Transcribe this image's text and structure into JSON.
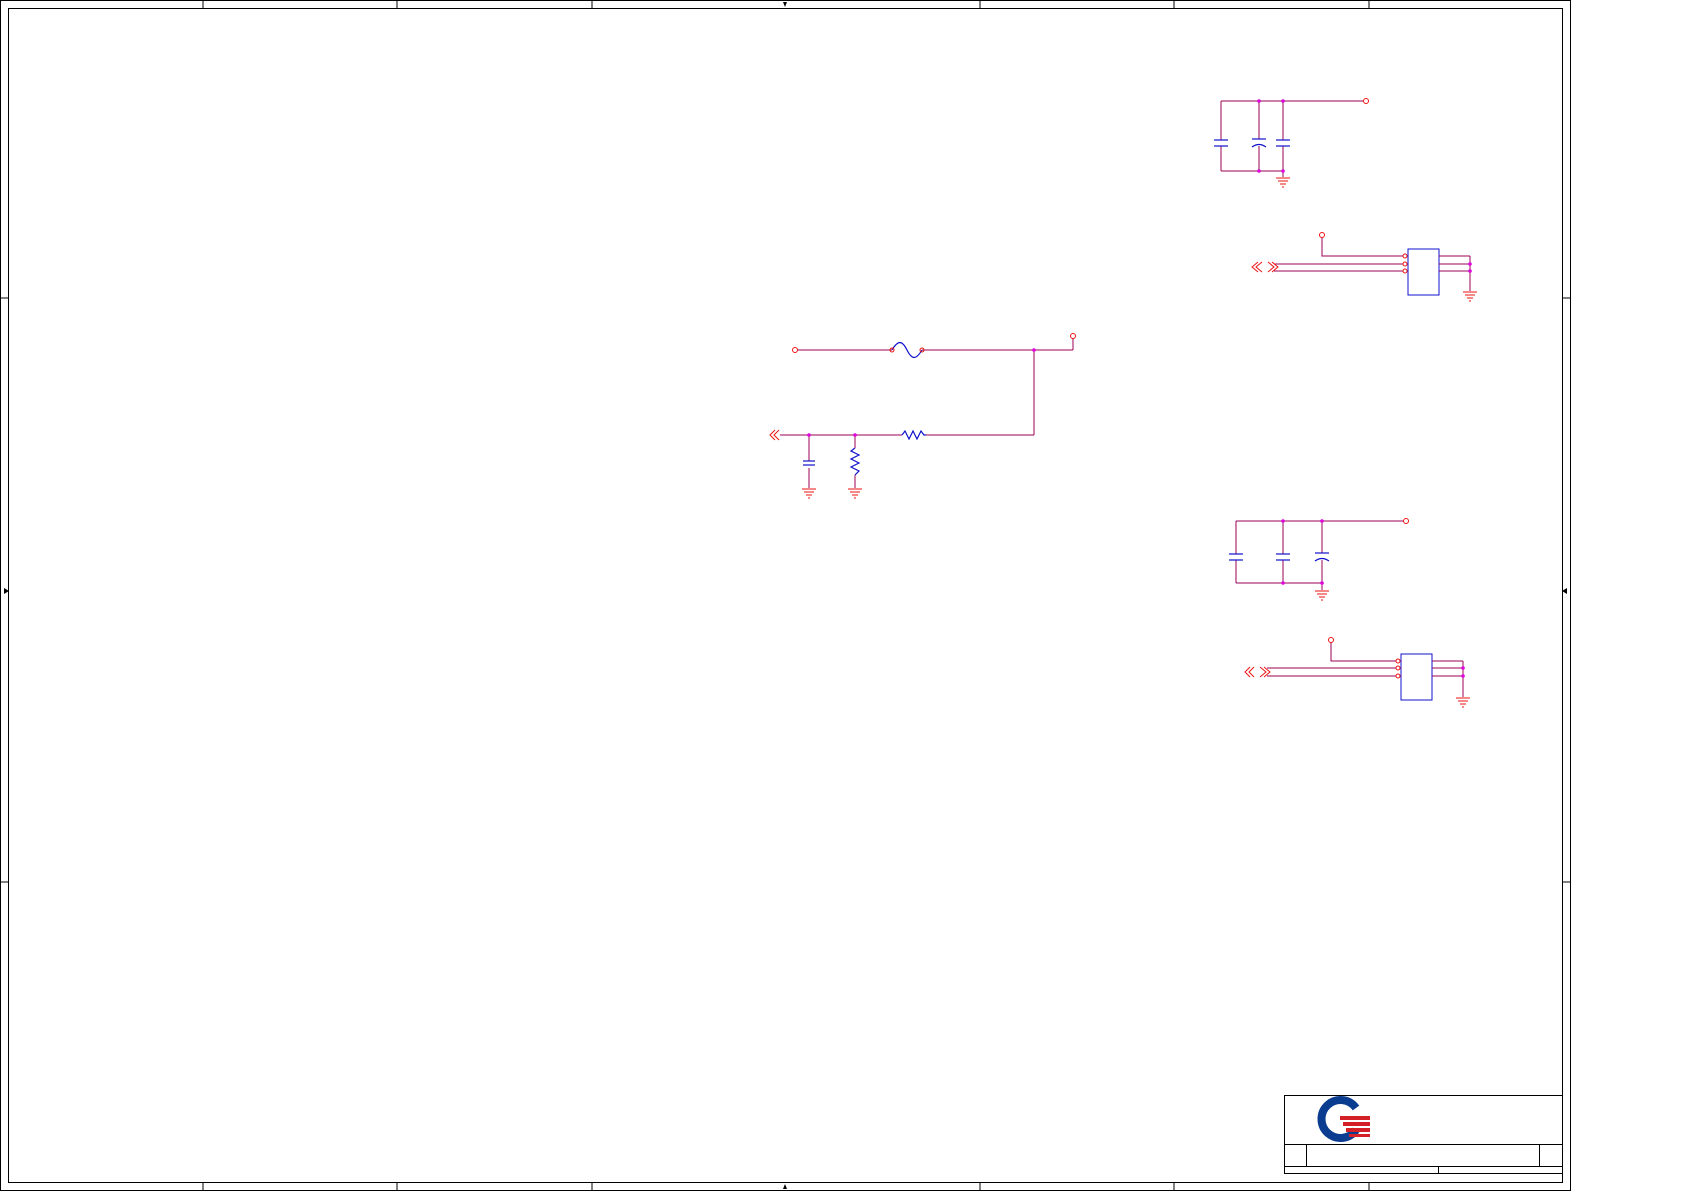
{
  "document": {
    "type": "schematic-sheet",
    "labels": []
  },
  "colors": {
    "wire": "#990055",
    "pin": "#ee1111",
    "component": "#1111cc",
    "junction": "#dd00dd",
    "frame": "#000000",
    "logo_blue": "#0a3d8f",
    "logo_red": "#d42027"
  },
  "title_block": {
    "logo": "company-logo",
    "fields": []
  }
}
